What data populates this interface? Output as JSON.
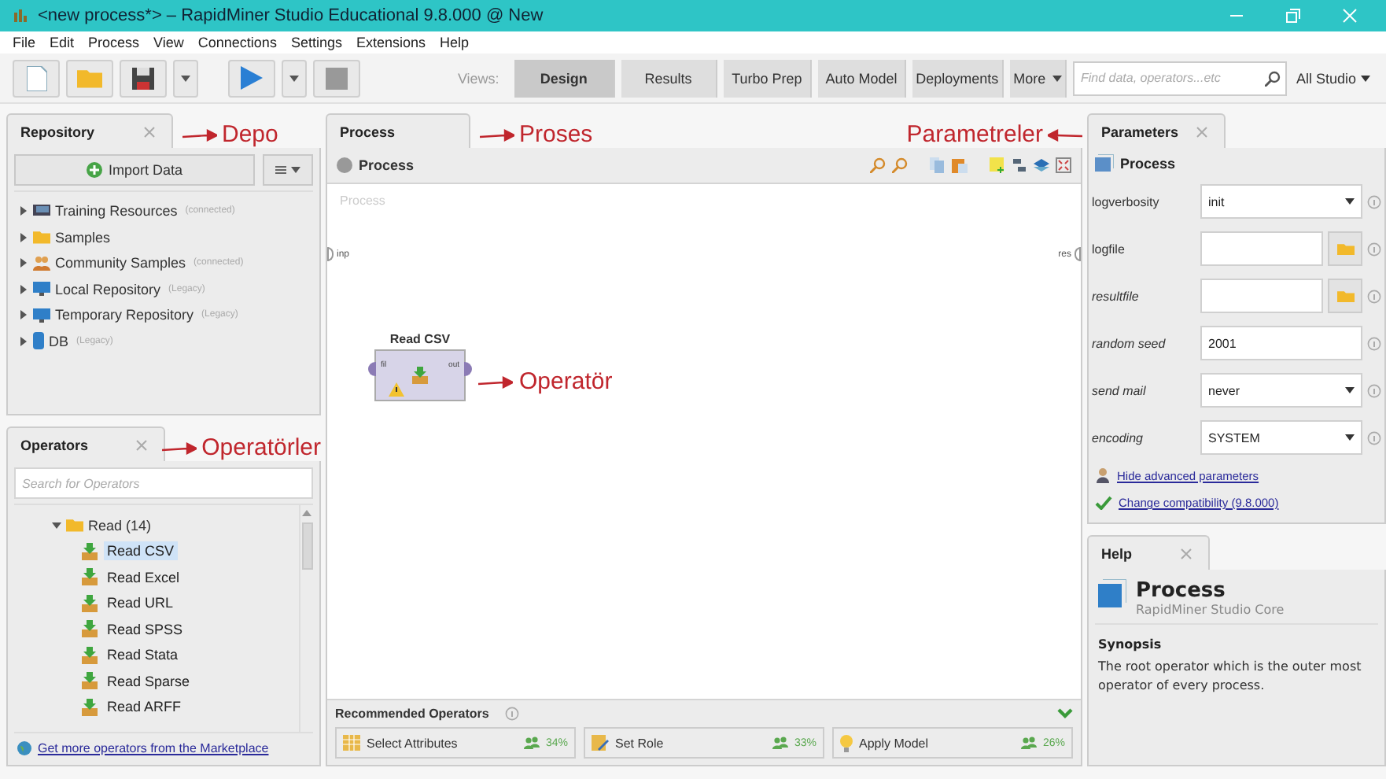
{
  "window": {
    "title": "<new process*> – RapidMiner Studio Educational 9.8.000 @ New"
  },
  "menu": [
    "File",
    "Edit",
    "Process",
    "View",
    "Connections",
    "Settings",
    "Extensions",
    "Help"
  ],
  "toolbar": {
    "views_label": "Views:",
    "views": [
      {
        "label": "Design",
        "selected": true
      },
      {
        "label": "Results",
        "selected": false
      },
      {
        "label": "Turbo Prep",
        "selected": false
      },
      {
        "label": "Auto Model",
        "selected": false
      },
      {
        "label": "Deployments",
        "selected": false
      },
      {
        "label": "More",
        "selected": false,
        "dropdown": true
      }
    ],
    "search": {
      "placeholder": "Find data, operators...etc"
    },
    "scope": "All Studio"
  },
  "repository": {
    "tab": "Repository",
    "annotation": "Depo",
    "import_button": "Import Data",
    "items": [
      {
        "kind": "training",
        "name": "Training Resources",
        "note": "(connected)",
        "expanded": false
      },
      {
        "kind": "folder",
        "name": "Samples",
        "expanded": false
      },
      {
        "kind": "community",
        "name": "Community Samples",
        "note": "(connected)",
        "expanded": false
      },
      {
        "kind": "local",
        "name": "Local Repository",
        "note": "(Legacy)",
        "expanded": false
      },
      {
        "kind": "local",
        "name": "Temporary Repository",
        "note": "(Legacy)",
        "expanded": false
      },
      {
        "kind": "db",
        "name": "DB",
        "note": "(Legacy)",
        "expanded": false
      }
    ]
  },
  "operators": {
    "tab": "Operators",
    "annotation": "Operatörler",
    "search": {
      "placeholder": "Search for Operators"
    },
    "tree": {
      "label": "Read (14)",
      "expanded": true,
      "children": [
        {
          "label": "Read CSV",
          "selected": true
        },
        {
          "label": "Read Excel",
          "selected": false
        },
        {
          "label": "Read URL",
          "selected": false
        },
        {
          "label": "Read SPSS",
          "selected": false
        },
        {
          "label": "Read Stata",
          "selected": false
        },
        {
          "label": "Read Sparse",
          "selected": false
        },
        {
          "label": "Read ARFF",
          "selected": false
        }
      ]
    },
    "marketplace_link": "Get more operators from the Marketplace"
  },
  "process": {
    "tab": "Process",
    "annotation": "Proses",
    "breadcrumb": "Process",
    "canvas_label": "Process",
    "input_port": "inp",
    "result_port": "res",
    "operator": {
      "name": "Read CSV",
      "input_port": "fil",
      "output_port": "out",
      "warning": true
    },
    "operator_annotation": "Operatör",
    "recommended": {
      "title": "Recommended Operators",
      "expanded": true,
      "items": [
        {
          "kind": "table",
          "name": "Select Attributes",
          "share": "34%"
        },
        {
          "kind": "role",
          "name": "Set Role",
          "share": "33%"
        },
        {
          "kind": "bulb",
          "name": "Apply Model",
          "share": "26%"
        }
      ]
    }
  },
  "parameters": {
    "tab": "Parameters",
    "annotation": "Parametreler",
    "title": "Process",
    "rows": [
      {
        "label": "logverbosity",
        "kind": "select",
        "value": "init",
        "advanced": false
      },
      {
        "label": "logfile",
        "kind": "file",
        "advanced": false
      },
      {
        "label": "resultfile",
        "kind": "file",
        "advanced": true
      },
      {
        "label": "random seed",
        "kind": "text",
        "value": "2001",
        "advanced": true
      },
      {
        "label": "send mail",
        "kind": "select",
        "value": "never",
        "advanced": true
      },
      {
        "label": "encoding",
        "kind": "select",
        "value": "SYSTEM",
        "advanced": true
      }
    ],
    "links": [
      {
        "kind": "user",
        "text": "Hide advanced parameters"
      },
      {
        "kind": "check",
        "text": "Change compatibility (9.8.000)"
      }
    ]
  },
  "help": {
    "tab": "Help",
    "title": "Process",
    "subtitle": "RapidMiner Studio Core",
    "section": "Synopsis",
    "text": "The root operator which is the outer most operator of every process."
  }
}
